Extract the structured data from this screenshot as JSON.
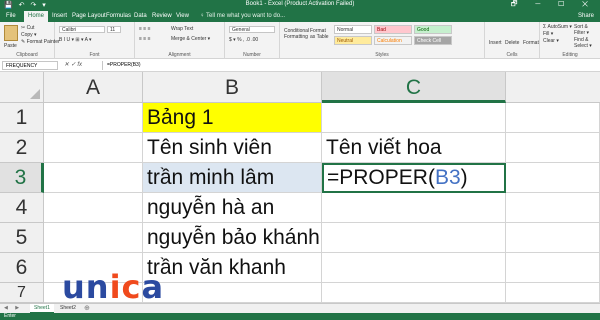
{
  "window": {
    "title": "Book1 - Excel (Product Activation Failed)",
    "qat": "💾 ↶ ↷ ▾",
    "controls": "🗗 ─ ☐ ✕"
  },
  "ribbon_tabs": {
    "file": "File",
    "home": "Home",
    "insert": "Insert",
    "page_layout": "Page Layout",
    "formulas": "Formulas",
    "data": "Data",
    "review": "Review",
    "view": "View",
    "tell_me": "♀ Tell me what you want to do...",
    "share": "Share"
  },
  "ribbon": {
    "clipboard": {
      "label": "Clipboard",
      "paste": "Paste",
      "cut": "✂ Cut",
      "copy": "Copy ▾",
      "format_painter": "✎ Format Painter"
    },
    "font": {
      "label": "Font",
      "font_name": "Calibri",
      "font_size": "11",
      "style_buttons": "B I U ▾  ⊞ ▾  A ▾"
    },
    "alignment": {
      "label": "Alignment",
      "wrap_text": "Wrap Text",
      "merge_center": "Merge & Center ▾"
    },
    "number": {
      "label": "Number",
      "format": "General",
      "symbols": "$ ▾ %  ,  .0 .00"
    },
    "styles": {
      "label": "Styles",
      "conditional": "Conditional Formatting",
      "format_table": "Format as Table",
      "normal": "Normal",
      "bad": "Bad",
      "good": "Good",
      "neutral": "Neutral",
      "calculation": "Calculation",
      "check_cell": "Check Cell"
    },
    "cells": {
      "label": "Cells",
      "insert": "Insert",
      "delete": "Delete",
      "format": "Format"
    },
    "editing": {
      "label": "Editing",
      "autosum": "Σ AutoSum ▾",
      "fill": "Fill ▾",
      "clear": "Clear ▾",
      "sort_filter": "Sort & Filter ▾",
      "find_select": "Find & Select ▾"
    }
  },
  "formula_bar": {
    "name_box": "FREQUENCY",
    "fx_icons": "✕ ✓ fx",
    "formula": "=PROPER(B3)"
  },
  "columns": [
    "A",
    "B",
    "C"
  ],
  "rows": [
    "1",
    "2",
    "3",
    "4",
    "5",
    "6",
    "7"
  ],
  "cells": {
    "b1": "Bảng 1",
    "b2": "Tên sinh viên",
    "c2": "Tên viết hoa",
    "b3": "trần minh lâm",
    "c3_prefix": "=PROPER(",
    "c3_ref": "B3",
    "c3_suffix": ")",
    "b4": "nguyễn hà an",
    "b5": "nguyễn bảo khánh",
    "b6": "trần văn khanh"
  },
  "sheet_tabs": {
    "nav": "◀ ▶",
    "sheet1": "Sheet1",
    "sheet2": "Sheet2",
    "add": "⊕"
  },
  "status_bar": {
    "mode": "Enter"
  },
  "logo": {
    "letters": [
      "u",
      "n",
      "i",
      "c",
      "a"
    ],
    "colors": [
      "#2b4aa0",
      "#2b4aa0",
      "#f04a1d",
      "#f04a1d",
      "#2b4aa0"
    ]
  },
  "colors": {
    "excel_green": "#217346",
    "highlight_yellow": "#ffff00",
    "selection_blue": "#dce6f1",
    "reference_blue": "#4472c4"
  }
}
